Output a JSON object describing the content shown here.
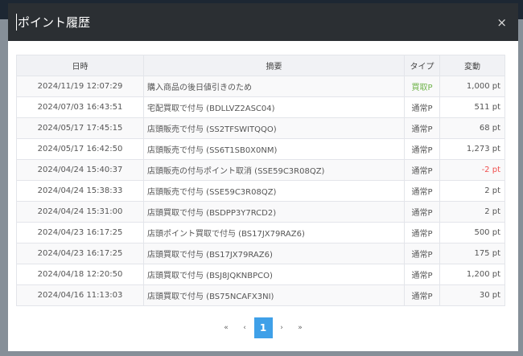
{
  "modal": {
    "title": "ポイント履歴",
    "close": "×"
  },
  "table": {
    "headers": [
      "日時",
      "摘要",
      "タイプ",
      "変動"
    ],
    "rows": [
      {
        "date": "2024/11/19 12:07:29",
        "summary": "購入商品の後日値引きのため",
        "type": "買取P",
        "amount": "1,000 pt",
        "type_color": "green"
      },
      {
        "date": "2024/07/03 16:43:51",
        "summary": "宅配買取で付与 (BDLLVZ2ASC04)",
        "type": "通常P",
        "amount": "511 pt"
      },
      {
        "date": "2024/05/17 17:45:15",
        "summary": "店頭販売で付与 (SS2TFSWITQQO)",
        "type": "通常P",
        "amount": "68 pt"
      },
      {
        "date": "2024/05/17 16:42:50",
        "summary": "店頭販売で付与 (SS6T1SB0X0NM)",
        "type": "通常P",
        "amount": "1,273 pt"
      },
      {
        "date": "2024/04/24 15:40:37",
        "summary": "店頭販売の付与ポイント取消 (SSE59C3R08QZ)",
        "type": "通常P",
        "amount": "-2 pt",
        "amount_color": "red"
      },
      {
        "date": "2024/04/24 15:38:33",
        "summary": "店頭販売で付与 (SSE59C3R08QZ)",
        "type": "通常P",
        "amount": "2 pt"
      },
      {
        "date": "2024/04/24 15:31:00",
        "summary": "店頭買取で付与 (BSDPP3Y7RCD2)",
        "type": "通常P",
        "amount": "2 pt"
      },
      {
        "date": "2024/04/23 16:17:25",
        "summary": "店頭ポイント買取で付与 (BS17JX79RAZ6)",
        "type": "通常P",
        "amount": "500 pt"
      },
      {
        "date": "2024/04/23 16:17:25",
        "summary": "店頭買取で付与 (BS17JX79RAZ6)",
        "type": "通常P",
        "amount": "175 pt"
      },
      {
        "date": "2024/04/18 12:20:50",
        "summary": "店頭買取で付与 (BSJ8JQKNBPCO)",
        "type": "通常P",
        "amount": "1,200 pt"
      },
      {
        "date": "2024/04/16 11:13:03",
        "summary": "店頭買取で付与 (BS75NCAFX3NI)",
        "type": "通常P",
        "amount": "30 pt"
      }
    ]
  },
  "pager": {
    "first": "«",
    "prev": "‹",
    "current": "1",
    "next": "›",
    "last": "»"
  },
  "colors": {
    "header": "#2b2f33",
    "accent": "#3fa0e8",
    "green": "#6fb34a",
    "red": "#f0504f"
  }
}
